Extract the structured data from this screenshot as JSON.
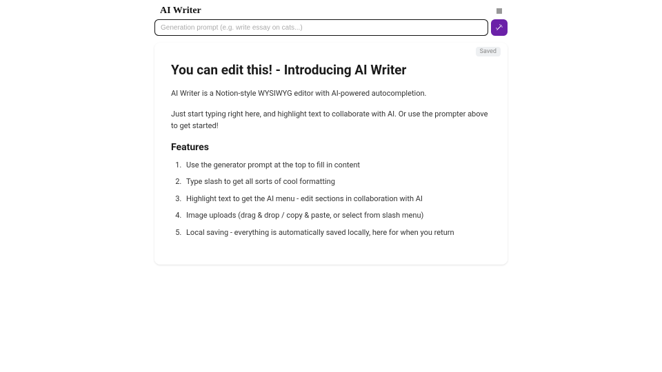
{
  "header": {
    "title": "AI Writer"
  },
  "prompt": {
    "placeholder": "Generation prompt (e.g. write essay on cats...)",
    "value": ""
  },
  "status": {
    "saved_label": "Saved"
  },
  "document": {
    "heading": "You can edit this! - Introducing AI Writer",
    "intro": "AI Writer is a Notion-style WYSIWYG editor with AI-powered autocompletion.",
    "instructions": "Just start typing right here, and highlight text to collaborate with AI. Or use the prompter above to get started!",
    "features_heading": "Features",
    "features": [
      "Use the generator prompt at the top to fill in content",
      "Type slash to get all sorts of cool formatting",
      "Highlight text to get the AI menu - edit sections in collaboration with AI",
      "Image uploads (drag & drop / copy & paste, or select from slash menu)",
      "Local saving - everything is automatically saved locally, here for when you return"
    ]
  },
  "colors": {
    "accent": "#6b21a8"
  }
}
